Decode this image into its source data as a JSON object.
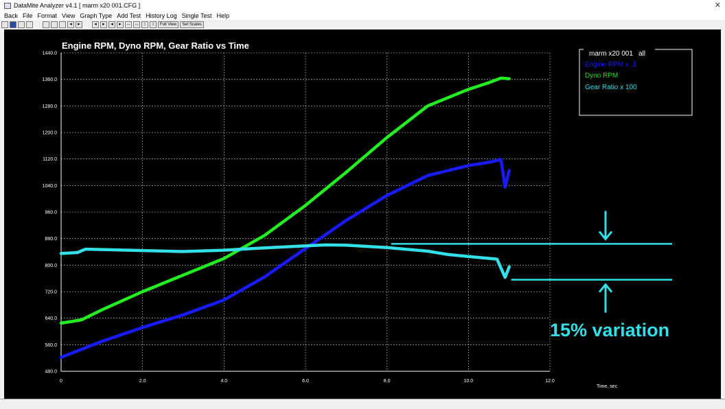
{
  "window": {
    "title": "DataMite Analyzer v4.1  [ marm x20 001.CFG ]"
  },
  "menu": [
    {
      "label": "Back"
    },
    {
      "label": "File"
    },
    {
      "label": "Format"
    },
    {
      "label": "View"
    },
    {
      "label": "Graph Type"
    },
    {
      "label": "Add Test"
    },
    {
      "label": "History Log"
    },
    {
      "label": "Single Test"
    },
    {
      "label": "Help"
    }
  ],
  "toolbar": {
    "full_view": "Full View",
    "set_scales": "Set Scales"
  },
  "colors": {
    "engine": "#1a1aff",
    "dyno": "#22ee22",
    "gear": "#33e0e8",
    "grid": "#cfcfcf",
    "legend_text_dyno": "#22dd22"
  },
  "chart_data": {
    "type": "line",
    "title": "Engine RPM, Dyno RPM, Gear Ratio vs Time",
    "xlabel": "Time, sec",
    "ylabel": "",
    "xlim": [
      0,
      12
    ],
    "ylim": [
      480,
      1440
    ],
    "x_ticks": [
      "0",
      "2.0",
      "4.0",
      "6.0",
      "8.0",
      "10.0",
      "12.0"
    ],
    "y_ticks": [
      "1440.0",
      "1360.0",
      "1280.0",
      "1200.0",
      "1120.0",
      "1040.0",
      "960.0",
      "880.0",
      "800.0",
      "720.0",
      "640.0",
      "560.0",
      "480.0"
    ],
    "grid": true,
    "legend": {
      "header": "marm x20 001",
      "header_suffix": "all",
      "placement": "top-right",
      "entries": [
        "Engine RPM x .1",
        "Dyno RPM",
        "Gear Ratio x 100"
      ]
    },
    "series": [
      {
        "name": "Engine RPM x .1",
        "x": [
          0,
          1,
          2,
          3,
          4,
          5,
          6,
          7,
          8,
          9,
          9.5,
          10,
          10.5,
          10.8,
          10.9,
          11.0
        ],
        "y": [
          522,
          570,
          612,
          650,
          695,
          765,
          850,
          935,
          1010,
          1070,
          1085,
          1100,
          1110,
          1118,
          1035,
          1085
        ]
      },
      {
        "name": "Dyno RPM",
        "x": [
          0,
          0.5,
          1,
          2,
          3,
          4,
          5,
          6,
          7,
          8,
          9,
          10,
          10.5,
          10.8,
          11.0
        ],
        "y": [
          625,
          635,
          665,
          720,
          770,
          820,
          890,
          980,
          1080,
          1185,
          1280,
          1330,
          1350,
          1364,
          1362
        ]
      },
      {
        "name": "Gear Ratio x 100",
        "x": [
          0,
          0.4,
          0.6,
          1,
          2,
          3,
          4,
          5,
          6,
          6.5,
          7,
          8,
          9,
          9.5,
          10,
          10.7,
          10.9,
          11.0
        ],
        "y": [
          835,
          838,
          848,
          847,
          844,
          841,
          845,
          852,
          858,
          861,
          860,
          853,
          842,
          832,
          826,
          818,
          763,
          795
        ]
      }
    ],
    "annotation": {
      "text": "15% variation",
      "upper_level": 864,
      "lower_level": 756,
      "from_x": 8.1,
      "to_x": 15.0
    }
  }
}
